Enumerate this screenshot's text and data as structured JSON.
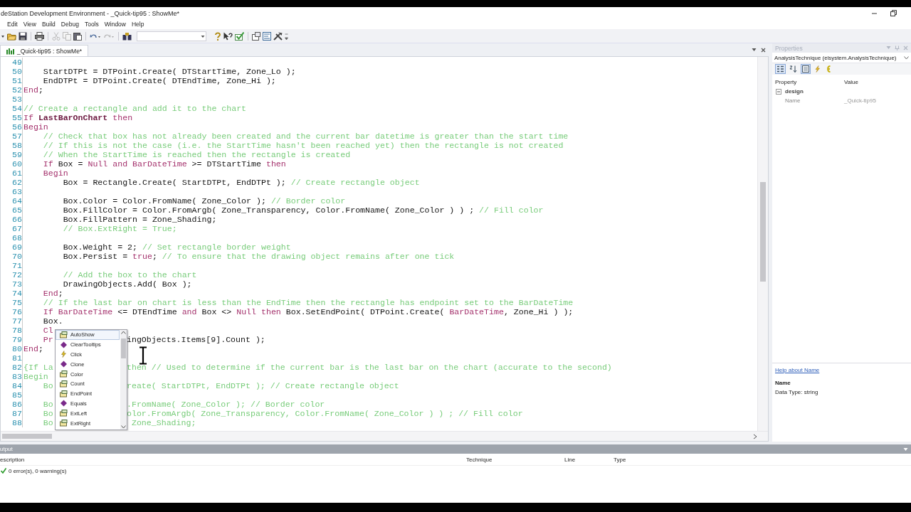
{
  "window": {
    "title": "deStation Development Environment - _Quick-tip95 : ShowMe*"
  },
  "menu": [
    "Edit",
    "View",
    "Build",
    "Debug",
    "Tools",
    "Window",
    "Help"
  ],
  "document_tab": {
    "label": "_Quick-tip95 : ShowMe*",
    "selected": true
  },
  "editor": {
    "lines": [
      {
        "number": "49"
      },
      {
        "number": "50",
        "segments": [
          {
            "text": "    StartDTPt = DTPoint.Create( DTStartTime, Zone_Lo );",
            "kind": "code"
          }
        ]
      },
      {
        "number": "51",
        "segments": [
          {
            "text": "    EndDTPt = DTPoint.Create( DTEndTime, Zone_Hi );",
            "kind": "code"
          }
        ]
      },
      {
        "number": "52",
        "segments": [
          {
            "text": "End",
            "kind": "keyword"
          },
          {
            "text": ";",
            "kind": "code"
          }
        ]
      },
      {
        "number": "53"
      },
      {
        "number": "54",
        "segments": [
          {
            "text": "// Create a rectangle and add it to the chart",
            "kind": "comment"
          }
        ]
      },
      {
        "number": "55",
        "segments": [
          {
            "text": "If",
            "kind": "keyword"
          },
          {
            "text": " LastBarOnChart",
            "kind": "reserved"
          },
          {
            "text": " then",
            "kind": "keyword"
          }
        ]
      },
      {
        "number": "56",
        "segments": [
          {
            "text": "Begin",
            "kind": "keyword"
          }
        ]
      },
      {
        "number": "57",
        "segments": [
          {
            "text": "    // Check that box has not already been created and the current bar datetime is greater than the start time",
            "kind": "comment"
          }
        ]
      },
      {
        "number": "58",
        "segments": [
          {
            "text": "    // If this is not the case (i.e. the StartTime hasn't been reached yet) then the rectangle is not created",
            "kind": "comment"
          }
        ]
      },
      {
        "number": "59",
        "segments": [
          {
            "text": "    // When the StartTime is reached then the rectangle is created",
            "kind": "comment"
          }
        ]
      },
      {
        "number": "60",
        "segments": [
          {
            "text": "    If",
            "kind": "keyword"
          },
          {
            "text": " Box = ",
            "kind": "code"
          },
          {
            "text": "Null and BarDateTime",
            "kind": "keyword"
          },
          {
            "text": " >= DTStartTime ",
            "kind": "code"
          },
          {
            "text": "then",
            "kind": "keyword"
          }
        ]
      },
      {
        "number": "61",
        "segments": [
          {
            "text": "    Begin",
            "kind": "keyword"
          }
        ]
      },
      {
        "number": "62",
        "segments": [
          {
            "text": "        Box = Rectangle.Create( StartDTPt, EndDTPt ); ",
            "kind": "code"
          },
          {
            "text": "// Create rectangle object",
            "kind": "comment"
          }
        ]
      },
      {
        "number": "63"
      },
      {
        "number": "64",
        "segments": [
          {
            "text": "        Box.Color = Color.FromName( Zone_Color ); ",
            "kind": "code"
          },
          {
            "text": "// Border color",
            "kind": "comment"
          }
        ]
      },
      {
        "number": "65",
        "segments": [
          {
            "text": "        Box.FillColor = Color.FromArgb( Zone_Transparency, Color.FromName( Zone_Color ) ) ; ",
            "kind": "code"
          },
          {
            "text": "// Fill color",
            "kind": "comment"
          }
        ]
      },
      {
        "number": "66",
        "segments": [
          {
            "text": "        Box.FillPattern = Zone_Shading;",
            "kind": "code"
          }
        ]
      },
      {
        "number": "67",
        "segments": [
          {
            "text": "        // Box.ExtRight = True;",
            "kind": "comment"
          }
        ]
      },
      {
        "number": "68"
      },
      {
        "number": "69",
        "segments": [
          {
            "text": "        Box.Weight = 2; ",
            "kind": "code"
          },
          {
            "text": "// Set rectangle border weight",
            "kind": "comment"
          }
        ]
      },
      {
        "number": "70",
        "segments": [
          {
            "text": "        Box.Persist = ",
            "kind": "code"
          },
          {
            "text": "true",
            "kind": "keyword"
          },
          {
            "text": "; ",
            "kind": "code"
          },
          {
            "text": "// To ensure that the drawing object remains after one tick",
            "kind": "comment"
          }
        ]
      },
      {
        "number": "71"
      },
      {
        "number": "72",
        "segments": [
          {
            "text": "        // Add the box to the chart",
            "kind": "comment"
          }
        ]
      },
      {
        "number": "73",
        "segments": [
          {
            "text": "        DrawingObjects.Add( Box );",
            "kind": "code"
          }
        ]
      },
      {
        "number": "74",
        "segments": [
          {
            "text": "    End",
            "kind": "keyword"
          },
          {
            "text": ";",
            "kind": "code"
          }
        ]
      },
      {
        "number": "75",
        "segments": [
          {
            "text": "    // If the last bar on chart is less than the EndTime then the rectangle has endpoint set to the BarDateTime",
            "kind": "comment"
          }
        ]
      },
      {
        "number": "76",
        "segments": [
          {
            "text": "    If ",
            "kind": "keyword"
          },
          {
            "text": "BarDateTime",
            "kind": "keyword"
          },
          {
            "text": " <= DTEndTime ",
            "kind": "code"
          },
          {
            "text": "and",
            "kind": "keyword"
          },
          {
            "text": " Box <> ",
            "kind": "code"
          },
          {
            "text": "Null then",
            "kind": "keyword"
          },
          {
            "text": " Box.SetEndPoint( DTPoint.Create( ",
            "kind": "code"
          },
          {
            "text": "BarDateTime",
            "kind": "keyword"
          },
          {
            "text": ", Zone_Hi ) );",
            "kind": "code"
          }
        ]
      },
      {
        "number": "77",
        "segments": [
          {
            "text": "    Box.",
            "kind": "code"
          }
        ]
      },
      {
        "number": "78",
        "segments": [
          {
            "text": "    Cl",
            "kind": "keyword"
          }
        ]
      },
      {
        "number": "79",
        "segments": [
          {
            "text": "    Pr",
            "kind": "keyword"
          },
          {
            "text": "ingObjects.Items[9].Count );",
            "kind": "code",
            "after_popup": true
          }
        ]
      },
      {
        "number": "80",
        "segments": [
          {
            "text": "End",
            "kind": "keyword"
          },
          {
            "text": ";",
            "kind": "code"
          }
        ]
      },
      {
        "number": "81"
      },
      {
        "number": "82",
        "segments": [
          {
            "text": "{If La",
            "kind": "comment"
          },
          {
            "text": "then // Used to determine if the current bar is the last bar on the chart (accurate to the second)",
            "kind": "comment",
            "after_popup": true
          }
        ]
      },
      {
        "number": "83",
        "segments": [
          {
            "text": "Begin",
            "kind": "comment"
          }
        ]
      },
      {
        "number": "84",
        "segments": [
          {
            "text": "    Bo",
            "kind": "comment"
          },
          {
            "text": "reate( StartDTPt, EndDTPt ); // Create rectangle object",
            "kind": "comment",
            "after_popup": true
          }
        ]
      },
      {
        "number": "85"
      },
      {
        "number": "86",
        "segments": [
          {
            "text": "    Bo",
            "kind": "comment"
          },
          {
            "text": ".FromName( Zone_Color ); // Border color",
            "kind": "comment",
            "after_popup": true
          }
        ]
      },
      {
        "number": "87",
        "segments": [
          {
            "text": "    Bo",
            "kind": "comment"
          },
          {
            "text": "olor.FromArgb( Zone_Transparency, Color.FromName( Zone_Color ) ) ; // Fill color",
            "kind": "comment",
            "after_popup": true
          }
        ]
      },
      {
        "number": "88",
        "segments": [
          {
            "text": "    Bo",
            "kind": "comment"
          },
          {
            "text": " Zone_Shading;",
            "kind": "comment",
            "after_popup": true
          }
        ]
      }
    ],
    "completion_list": [
      {
        "label": "AutoShow",
        "kind": "property",
        "selected": true
      },
      {
        "label": "ClearTooltips",
        "kind": "method",
        "selected": false
      },
      {
        "label": "Click",
        "kind": "event",
        "selected": false
      },
      {
        "label": "Clone",
        "kind": "method",
        "selected": false
      },
      {
        "label": "Color",
        "kind": "property",
        "selected": false
      },
      {
        "label": "Count",
        "kind": "property",
        "selected": false
      },
      {
        "label": "EndPoint",
        "kind": "property",
        "selected": false
      },
      {
        "label": "Equals",
        "kind": "method",
        "selected": false
      },
      {
        "label": "ExtLeft",
        "kind": "property",
        "selected": false
      },
      {
        "label": "ExtRight",
        "kind": "property",
        "selected": false
      }
    ]
  },
  "properties": {
    "title": "Properties",
    "object": "AnalysisTechnique (elsystem.AnalysisTechnique)",
    "columns": [
      "Property",
      "Value"
    ],
    "groups": [
      {
        "name": "design",
        "expanded": true,
        "rows": [
          {
            "property": "Name",
            "value": "_Quick-tip95"
          }
        ]
      }
    ],
    "help_link": "Help about Name",
    "help_title": "Name",
    "help_text": "Data Type: string"
  },
  "output": {
    "title": "utput",
    "columns": [
      "escription",
      "Technique",
      "Line",
      "Type"
    ],
    "message": "0 error(s), 0 warning(s)"
  }
}
